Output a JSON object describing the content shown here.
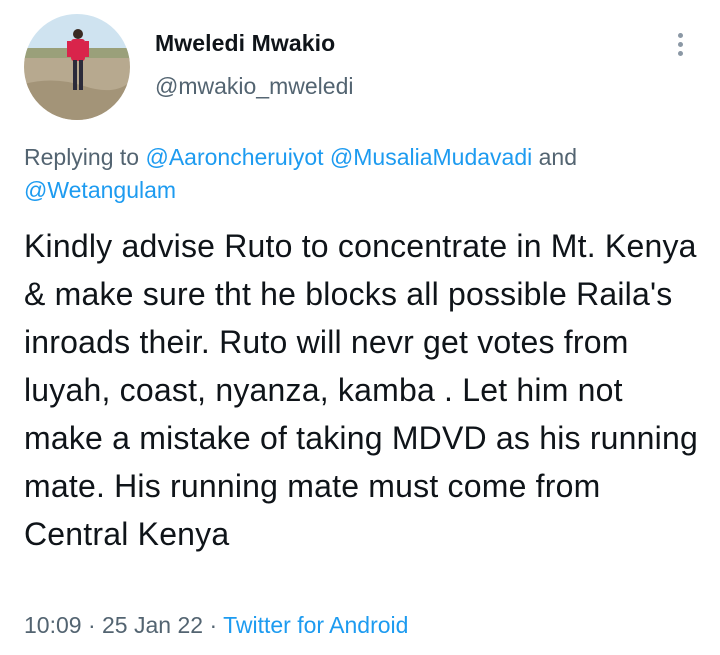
{
  "author": {
    "display_name": "Mweledi Mwakio",
    "handle": "@mwakio_mweledi",
    "avatar_icon": "profile-photo"
  },
  "more_icon": "more-vertical-icon",
  "replying": {
    "prefix": "Replying to ",
    "mention_1": "@Aaroncheruiyot",
    "mention_2": "@MusaliaMudavadi",
    "conjunction": "and",
    "mention_3": "@Wetangulam"
  },
  "tweet": {
    "text": "Kindly advise Ruto to concentrate in Mt. Kenya & make sure tht he blocks all possible Raila's inroads their. Ruto will nevr get votes from luyah, coast, nyanza, kamba . Let him not make a mistake of taking MDVD as his running mate. His running mate must come from Central Kenya"
  },
  "meta": {
    "time": "10:09",
    "separator": "·",
    "date": "25 Jan 22",
    "source": "Twitter for Android"
  },
  "colors": {
    "link": "#1d9bf0",
    "secondary_text": "#536471",
    "primary_text": "#0f1419"
  }
}
